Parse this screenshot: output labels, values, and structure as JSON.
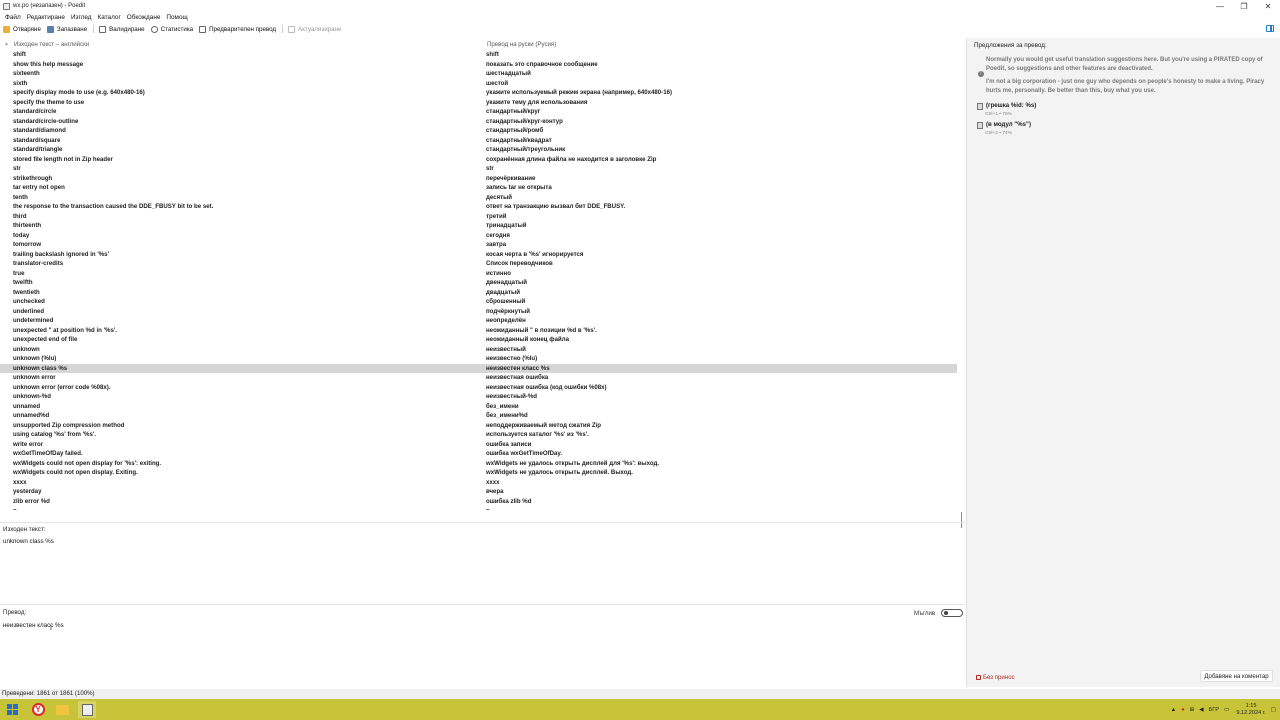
{
  "window": {
    "title": "wx.po (незапазен) - Poedit",
    "controls": [
      "—",
      "❐",
      "✕"
    ]
  },
  "menu": [
    "Файл",
    "Редактиране",
    "Изглед",
    "Каталог",
    "Обкождане",
    "Помощ"
  ],
  "toolbar": {
    "open": "Отваряне",
    "save": "Запазване",
    "validate": "Валидиране",
    "stats": "Статистика",
    "pretranslate": "Предварителен превод",
    "update": "Актуализиране"
  },
  "list": {
    "col_source": "Изходен текст – английски",
    "col_translation": "Превод на руски (Русия)",
    "rows": [
      {
        "src": "shift",
        "trans": "shift"
      },
      {
        "src": "show this help message",
        "trans": "показать это справочное сообщение"
      },
      {
        "src": "sixteenth",
        "trans": "шестнадцатый"
      },
      {
        "src": "sixth",
        "trans": "шестой"
      },
      {
        "src": "specify display mode to use (e.g. 640x480-16)",
        "trans": "укажите используемый режим экрана (например, 640x480-16)"
      },
      {
        "src": "specify the theme to use",
        "trans": "укажите тему для использования"
      },
      {
        "src": "standard/circle",
        "trans": "стандартный/круг"
      },
      {
        "src": "standard/circle-outline",
        "trans": "стандартный/круг-контур"
      },
      {
        "src": "standard/diamond",
        "trans": "стандартный/ромб"
      },
      {
        "src": "standard/square",
        "trans": "стандартный/квадрат"
      },
      {
        "src": "standard/triangle",
        "trans": "стандартный/треугольник"
      },
      {
        "src": "stored file length not in Zip header",
        "trans": "сохранённая длина файла не находится в заголовке Zip"
      },
      {
        "src": "str",
        "trans": "str"
      },
      {
        "src": "strikethrough",
        "trans": "перечёркивание"
      },
      {
        "src": "tar entry not open",
        "trans": "запись tar не открыта"
      },
      {
        "src": "tenth",
        "trans": "десятый"
      },
      {
        "src": "the response to the transaction caused the DDE_FBUSY bit to be set.",
        "trans": "ответ на транзакцию вызвал бит DDE_FBUSY."
      },
      {
        "src": "third",
        "trans": "третий"
      },
      {
        "src": "thirteenth",
        "trans": "тринадцатый"
      },
      {
        "src": "today",
        "trans": "сегодня"
      },
      {
        "src": "tomorrow",
        "trans": "завтра"
      },
      {
        "src": "trailing backslash ignored in '%s'",
        "trans": "косая черта в '%s' игнорируется"
      },
      {
        "src": "translator-credits",
        "trans": "Список переводчиков"
      },
      {
        "src": "true",
        "trans": "истинно"
      },
      {
        "src": "twelfth",
        "trans": "двенадцатый"
      },
      {
        "src": "twentieth",
        "trans": "двадцатый"
      },
      {
        "src": "unchecked",
        "trans": "сброшенный"
      },
      {
        "src": "underlined",
        "trans": "подчёркнутый"
      },
      {
        "src": "undetermined",
        "trans": "неопределён"
      },
      {
        "src": "unexpected \" at position %d in '%s'.",
        "trans": "неожиданный \" в позиции %d в '%s'."
      },
      {
        "src": "unexpected end of file",
        "trans": "неожиданный конец файла"
      },
      {
        "src": "unknown",
        "trans": "неизвестный"
      },
      {
        "src": "unknown (%lu)",
        "trans": "неизвестно (%lu)"
      },
      {
        "src": "unknown class %s",
        "trans": "неизвестен класс %s",
        "selected": true
      },
      {
        "src": "unknown error",
        "trans": "неизвестная ошибка"
      },
      {
        "src": "unknown error (error code %08x).",
        "trans": "неизвестная ошибка (код ошибки %08x)"
      },
      {
        "src": "unknown-%d",
        "trans": "неизвестный-%d"
      },
      {
        "src": "unnamed",
        "trans": "без_имени"
      },
      {
        "src": "unnamed%d",
        "trans": "без_имени%d"
      },
      {
        "src": "unsupported Zip compression method",
        "trans": "неподдерживаемый метод сжатия Zip"
      },
      {
        "src": "using catalog '%s' from '%s'.",
        "trans": "используется каталог '%s' из '%s'."
      },
      {
        "src": "write error",
        "trans": "ошибка записи"
      },
      {
        "src": "wxGetTimeOfDay failed.",
        "trans": "ошибка wxGetTimeOfDay."
      },
      {
        "src": "wxWidgets could not open display for '%s': exiting.",
        "trans": "wxWidgets не удалось открыть дисплей для '%s': выход."
      },
      {
        "src": "wxWidgets could not open display. Exiting.",
        "trans": "wxWidgets не удалось открыть дисплей. Выход."
      },
      {
        "src": "xxxx",
        "trans": "xxxx"
      },
      {
        "src": "yesterday",
        "trans": "вчера"
      },
      {
        "src": "zlib error %d",
        "trans": "ошибка zlib %d"
      },
      {
        "src": "~",
        "trans": "~"
      }
    ]
  },
  "source_pane": {
    "label": "Изходен текст:",
    "text": "unknown class %s"
  },
  "translation_pane": {
    "label": "Превод:",
    "text": "неизвестен класс %s",
    "fuzzy_label": "Мъглив",
    "fuzzy_on": false
  },
  "sidebar": {
    "title": "Предложения за превод:",
    "warning1": "Normally you would get useful translation suggestions here. But you're using a PIRATED copy of Poedit, so suggestions and other features are deactivated.",
    "warning2": "I'm not a big corporation - just one guy who depends on people's honesty to make a living. Piracy hurts me, personally. Be better than this, buy what you use.",
    "suggestions": [
      {
        "text": "(грешка %id: %s)",
        "meta": "Ctrl+1 • 75%"
      },
      {
        "text": "(в модул \"%s\")",
        "meta": "Ctrl+2 • 74%"
      }
    ],
    "no_contribution": "Без принос",
    "add_comment": "Добавяне на коментар"
  },
  "status": {
    "text": "Преведени: 1861 от 1861 (100%)"
  },
  "taskbar": {
    "tray_lang": "БГР",
    "time": "1:15",
    "date": "9.12.2024 г."
  },
  "colors": {
    "accent": "#2a7cc7",
    "selected_row": "#d6d6d6",
    "taskbar": "#c8c43a",
    "warning_text": "#7a7a7a",
    "no_contribution": "#b3261e"
  }
}
